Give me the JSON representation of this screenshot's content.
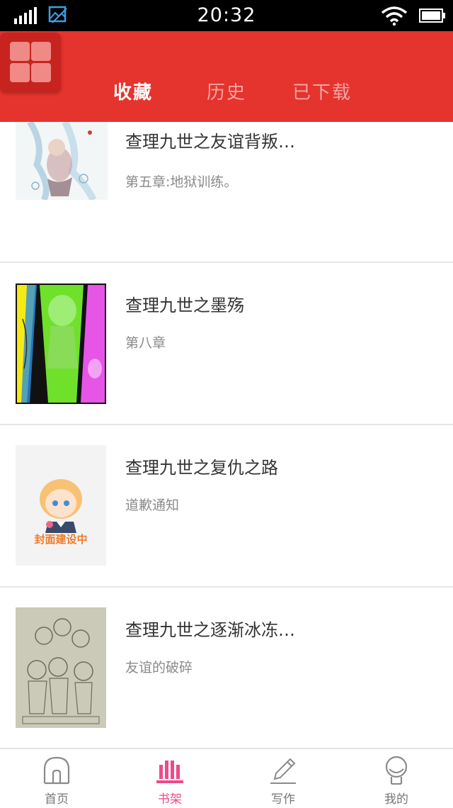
{
  "status_bar": {
    "time": "20:32"
  },
  "tabs": [
    {
      "label": "收藏",
      "active": true
    },
    {
      "label": "历史",
      "active": false
    },
    {
      "label": "已下载",
      "active": false
    }
  ],
  "books": [
    {
      "title": "查理九世之友谊背叛…",
      "chapter": "第五章:地狱训练。",
      "cover": "watercolor-illustration"
    },
    {
      "title": "查理九世之墨殇",
      "chapter": "第八章",
      "cover": "colorful-sketch"
    },
    {
      "title": "查理九世之复仇之路",
      "chapter": "道歉通知",
      "cover": "placeholder",
      "cover_text": "封面建设中"
    },
    {
      "title": "查理九世之逐渐冰冻…",
      "chapter": "友谊的破碎",
      "cover": "pencil-sketch"
    }
  ],
  "bottom_nav": [
    {
      "label": "首页",
      "icon": "home-icon",
      "active": false
    },
    {
      "label": "书架",
      "icon": "bookshelf-icon",
      "active": true
    },
    {
      "label": "写作",
      "icon": "pencil-icon",
      "active": false
    },
    {
      "label": "我的",
      "icon": "profile-icon",
      "active": false
    }
  ],
  "colors": {
    "header": "#e5332e",
    "active_nav": "#ee4a8a"
  }
}
